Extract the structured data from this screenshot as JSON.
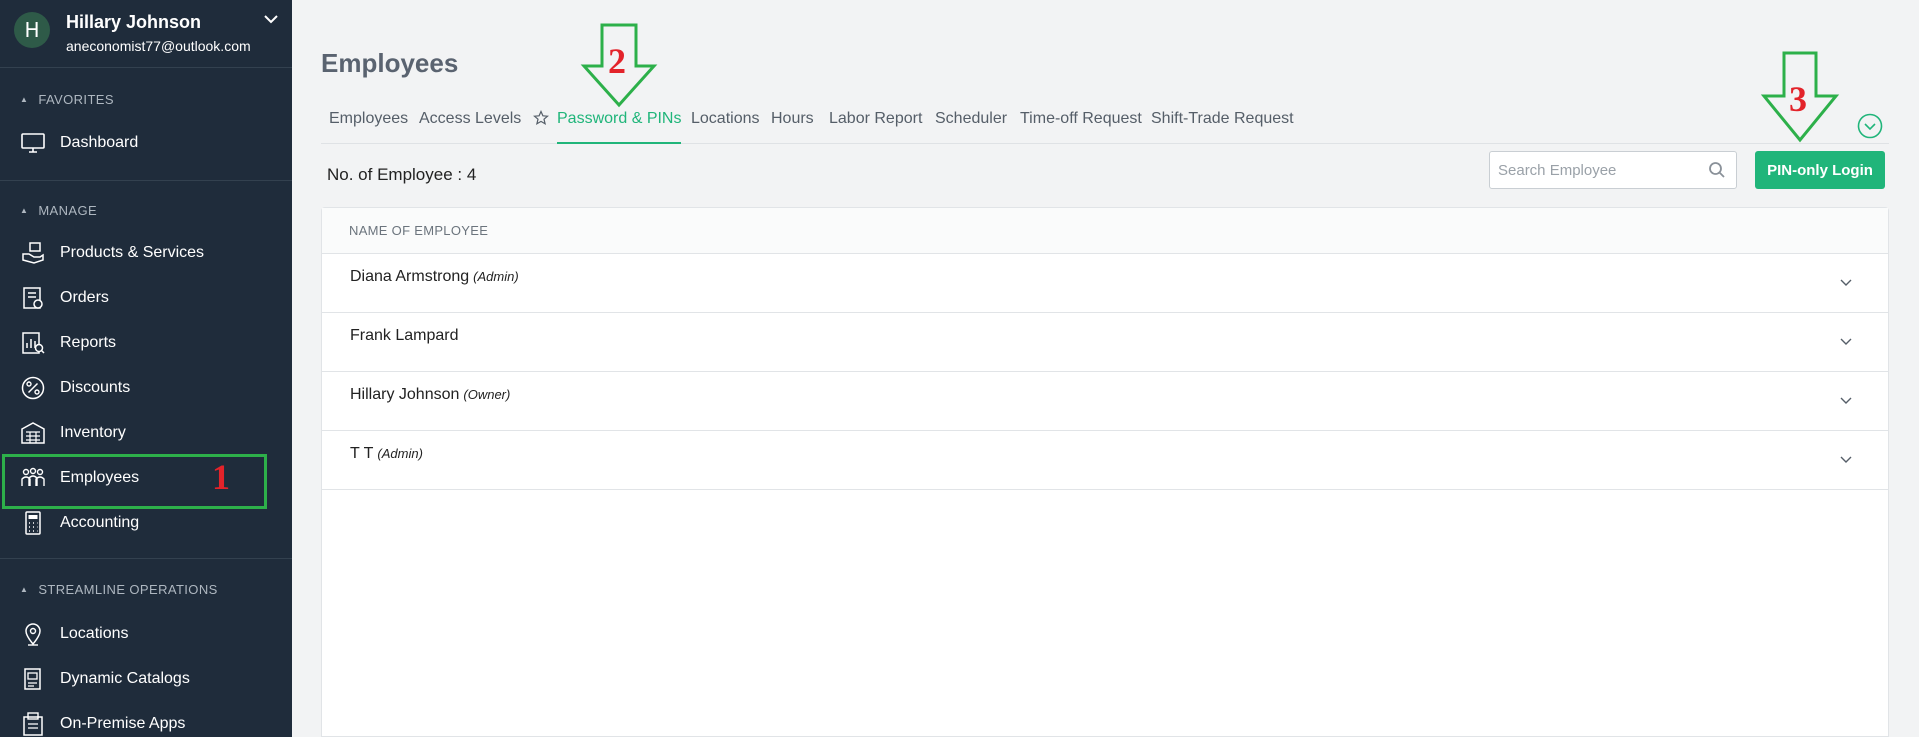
{
  "profile": {
    "initial": "H",
    "name": "Hillary Johnson",
    "email": "aneconomist77@outlook.com"
  },
  "sidebar": {
    "sections": [
      {
        "title": "FAVORITES"
      },
      {
        "title": "MANAGE"
      },
      {
        "title": "STREAMLINE OPERATIONS"
      }
    ],
    "items": [
      {
        "label": "Dashboard",
        "icon": "monitor-icon"
      },
      {
        "label": "Products & Services",
        "icon": "products-icon"
      },
      {
        "label": "Orders",
        "icon": "orders-icon"
      },
      {
        "label": "Reports",
        "icon": "reports-icon"
      },
      {
        "label": "Discounts",
        "icon": "percent-icon"
      },
      {
        "label": "Inventory",
        "icon": "inventory-icon"
      },
      {
        "label": "Employees",
        "icon": "employees-icon"
      },
      {
        "label": "Accounting",
        "icon": "calculator-icon"
      },
      {
        "label": "Locations",
        "icon": "location-pin-icon"
      },
      {
        "label": "Dynamic Catalogs",
        "icon": "catalog-icon"
      },
      {
        "label": "On-Premise Apps",
        "icon": "apps-icon"
      }
    ]
  },
  "annotations": {
    "one": "1",
    "two": "2",
    "three": "3",
    "highlight_color": "#2db04a",
    "number_color": "#e3232a"
  },
  "main": {
    "title": "Employees",
    "tabs": [
      {
        "label": "Employees"
      },
      {
        "label": "Access Levels"
      },
      {
        "label": "Password & PINs",
        "active": true
      },
      {
        "label": "Locations"
      },
      {
        "label": "Hours"
      },
      {
        "label": "Labor Report"
      },
      {
        "label": "Scheduler"
      },
      {
        "label": "Time-off Request"
      },
      {
        "label": "Shift-Trade Request"
      }
    ],
    "count_label": "No. of Employee : 4",
    "search_placeholder": "Search Employee",
    "pin_button": "PIN-only Login",
    "table_header": "NAME OF EMPLOYEE",
    "rows": [
      {
        "name": "Diana Armstrong",
        "role": "(Admin)"
      },
      {
        "name": "Frank Lampard",
        "role": ""
      },
      {
        "name": "Hillary Johnson",
        "role": "(Owner)"
      },
      {
        "name": "T T",
        "role": "(Admin)"
      }
    ],
    "accent_color": "#20b57a"
  }
}
